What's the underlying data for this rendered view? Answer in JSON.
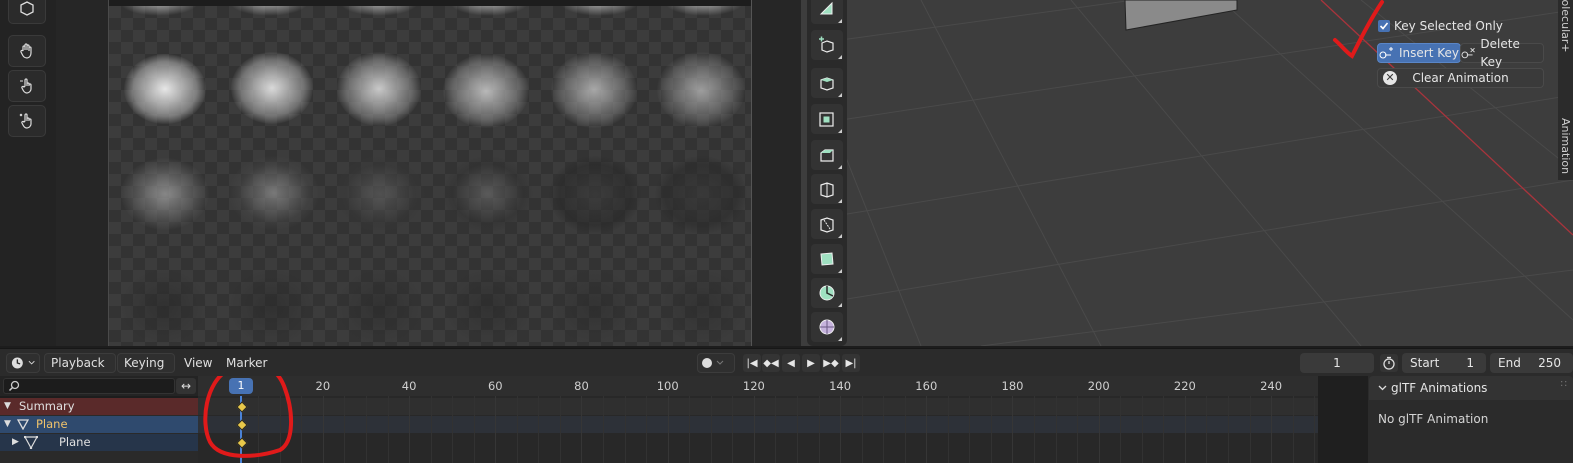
{
  "timeline": {
    "menus": {
      "playback": "Playback",
      "keying": "Keying",
      "view": "View",
      "marker": "Marker"
    },
    "current_frame": "1",
    "start_label": "Start",
    "start_value": "1",
    "end_label": "End",
    "end_value": "250",
    "ruler_badge": "1",
    "ruler_ticks": [
      "20",
      "40",
      "60",
      "80",
      "100",
      "120",
      "140",
      "160",
      "180",
      "200",
      "220",
      "240"
    ]
  },
  "channels": {
    "items": [
      {
        "label": "Summary"
      },
      {
        "label": "Plane"
      },
      {
        "label": "Plane"
      }
    ]
  },
  "animation_panel": {
    "key_selected_only": "Key Selected Only",
    "key_selected_only_checked": true,
    "insert_key": "Insert Key",
    "delete_key": "Delete Key",
    "clear_animation": "Clear Animation"
  },
  "sidebar_tabs": {
    "top": "Molecular+",
    "bottom": "Animation"
  },
  "gltf": {
    "title": "glTF Animations",
    "empty": "No glTF Animation"
  },
  "colors": {
    "accent": "#4772b3",
    "keyframe": "#e8c84a",
    "annotation": "#e01a1a",
    "summary_row": "#5a2a2a",
    "object_row": "#2f4a6e"
  },
  "icons": {
    "editor_type": "clock-icon",
    "search": "search-icon",
    "swap": "swap-arrows-icon",
    "hand_tools": "hand-icon",
    "auto_key": "record-dot-icon",
    "stopwatch": "stopwatch-icon"
  }
}
